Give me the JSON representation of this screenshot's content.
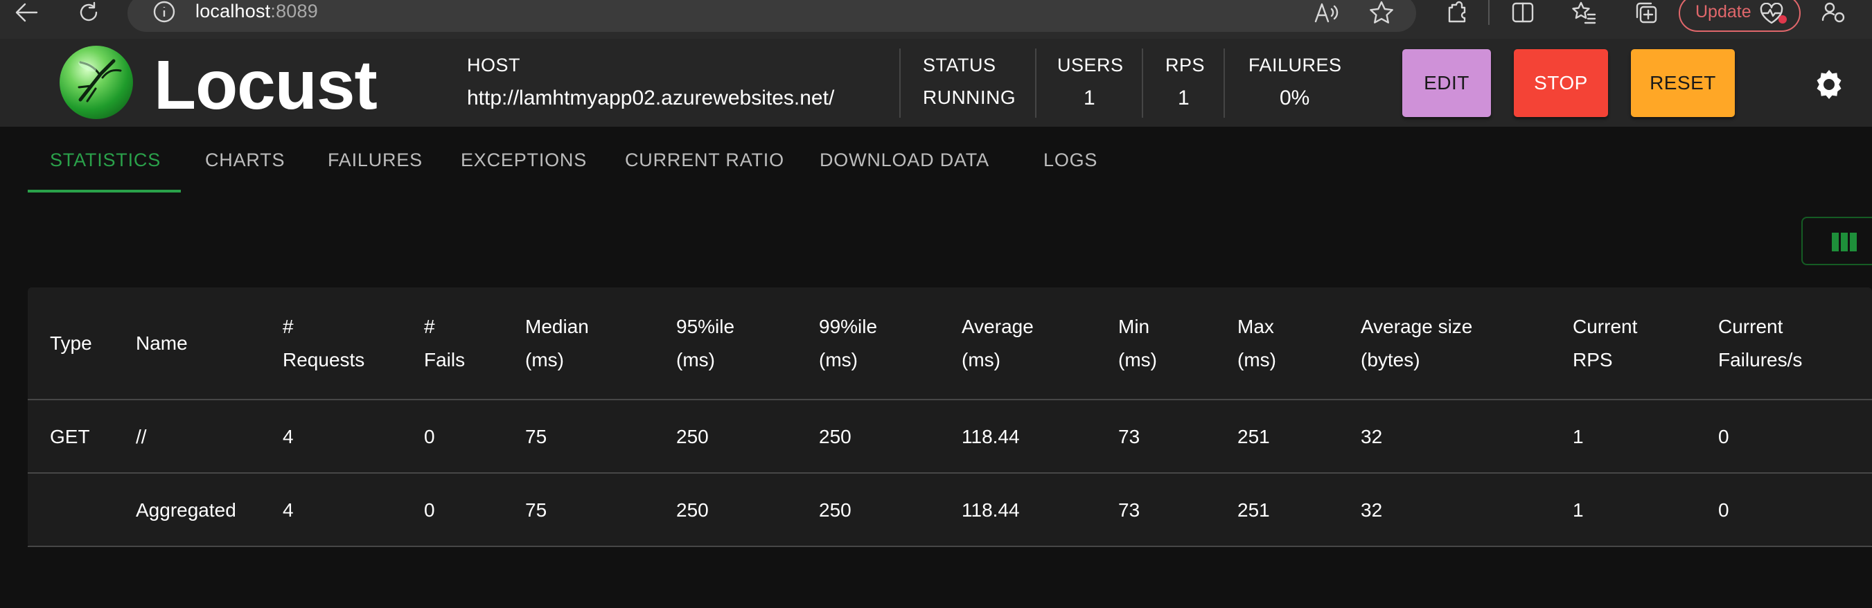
{
  "browser": {
    "url_host": "localhost",
    "url_port": ":8089",
    "update_label": "Update"
  },
  "header": {
    "brand": "Locust",
    "host_label": "HOST",
    "host_value": "http://lamhtmyapp02.azurewebsites.net/",
    "status_label": "STATUS",
    "status_value": "RUNNING",
    "users_label": "USERS",
    "users_value": "1",
    "rps_label": "RPS",
    "rps_value": "1",
    "failures_label": "FAILURES",
    "failures_value": "0%",
    "edit_label": "EDIT",
    "stop_label": "STOP",
    "reset_label": "RESET"
  },
  "tabs": [
    "STATISTICS",
    "CHARTS",
    "FAILURES",
    "EXCEPTIONS",
    "CURRENT RATIO",
    "DOWNLOAD DATA",
    "LOGS"
  ],
  "table": {
    "headers": [
      [
        "Type",
        ""
      ],
      [
        "Name",
        ""
      ],
      [
        "#",
        "Requests"
      ],
      [
        "#",
        "Fails"
      ],
      [
        "Median",
        "(ms)"
      ],
      [
        "95%ile",
        "(ms)"
      ],
      [
        "99%ile",
        "(ms)"
      ],
      [
        "Average",
        "(ms)"
      ],
      [
        "Min",
        "(ms)"
      ],
      [
        "Max",
        "(ms)"
      ],
      [
        "Average size",
        "(bytes)"
      ],
      [
        "Current",
        "RPS"
      ],
      [
        "Current",
        "Failures/s"
      ]
    ],
    "rows": [
      [
        "GET",
        "//",
        "4",
        "0",
        "75",
        "250",
        "250",
        "118.44",
        "73",
        "251",
        "32",
        "1",
        "0"
      ],
      [
        "",
        "Aggregated",
        "4",
        "0",
        "75",
        "250",
        "250",
        "118.44",
        "73",
        "251",
        "32",
        "1",
        "0"
      ]
    ]
  },
  "colors": {
    "accent_green": "#2aa14a",
    "edit": "#cf91d8",
    "stop": "#f44336",
    "reset": "#ffa726"
  },
  "icons": {
    "browser": [
      "back-arrow-icon",
      "reload-icon",
      "info-icon",
      "read-aloud-icon",
      "favorite-star-icon",
      "extensions-icon",
      "split-screen-icon",
      "favorites-icon",
      "collections-icon",
      "heartbeat-icon",
      "profile-icon"
    ],
    "header": [
      "locust-logo-icon",
      "theme-toggle-icon",
      "columns-icon"
    ]
  }
}
